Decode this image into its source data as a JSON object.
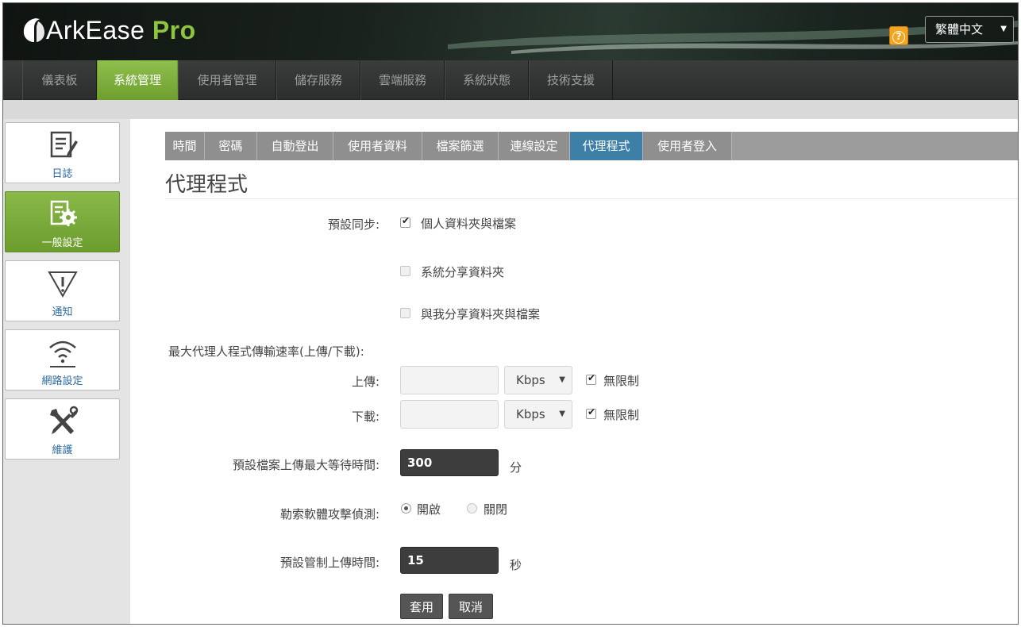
{
  "header": {
    "logo_main": "ArkEase",
    "logo_pro": "Pro",
    "help_glyph": "?",
    "language": "繁體中文"
  },
  "topnav": {
    "items": [
      "儀表板",
      "系統管理",
      "使用者管理",
      "儲存服務",
      "雲端服務",
      "系統狀態",
      "技術支援"
    ],
    "active": "系統管理"
  },
  "sidebar": {
    "items": [
      {
        "label": "日誌",
        "icon": "log-icon"
      },
      {
        "label": "一般設定",
        "icon": "settings-icon"
      },
      {
        "label": "通知",
        "icon": "warning-icon"
      },
      {
        "label": "網路設定",
        "icon": "wifi-icon"
      },
      {
        "label": "維護",
        "icon": "tools-icon"
      }
    ],
    "active": "一般設定"
  },
  "tabs": {
    "items": [
      "時間",
      "密碼",
      "自動登出",
      "使用者資料",
      "檔案篩選",
      "連線設定",
      "代理程式",
      "使用者登入"
    ],
    "active": "代理程式"
  },
  "page": {
    "title": "代理程式",
    "default_sync_label": "預設同步:",
    "sync_options": [
      {
        "label": "個人資料夾與檔案",
        "checked": true
      },
      {
        "label": "系統分享資料夾",
        "checked": false
      },
      {
        "label": "與我分享資料夾與檔案",
        "checked": false
      }
    ],
    "max_rate_label": "最大代理人程式傳輸速率(上傳/下載):",
    "upload_label": "上傳:",
    "upload_unit": "Kbps",
    "upload_unlimited_label": "無限制",
    "upload_unlimited": true,
    "download_label": "下載:",
    "download_unit": "Kbps",
    "download_unlimited_label": "無限制",
    "download_unlimited": true,
    "wait_time_label": "預設檔案上傳最大等待時間:",
    "wait_time_value": "300",
    "wait_time_unit": "分",
    "ransomware_label": "勒索軟體攻擊偵測:",
    "ransomware_on_label": "開啟",
    "ransomware_off_label": "關閉",
    "ransomware_selected": "開啟",
    "control_time_label": "預設管制上傳時間:",
    "control_time_value": "15",
    "control_time_unit": "秒",
    "apply_button": "套用",
    "cancel_button": "取消"
  },
  "colors": {
    "accent_green": "#7aab3a",
    "tab_active": "#3d7fa6",
    "link_blue": "#2d6a9f"
  }
}
